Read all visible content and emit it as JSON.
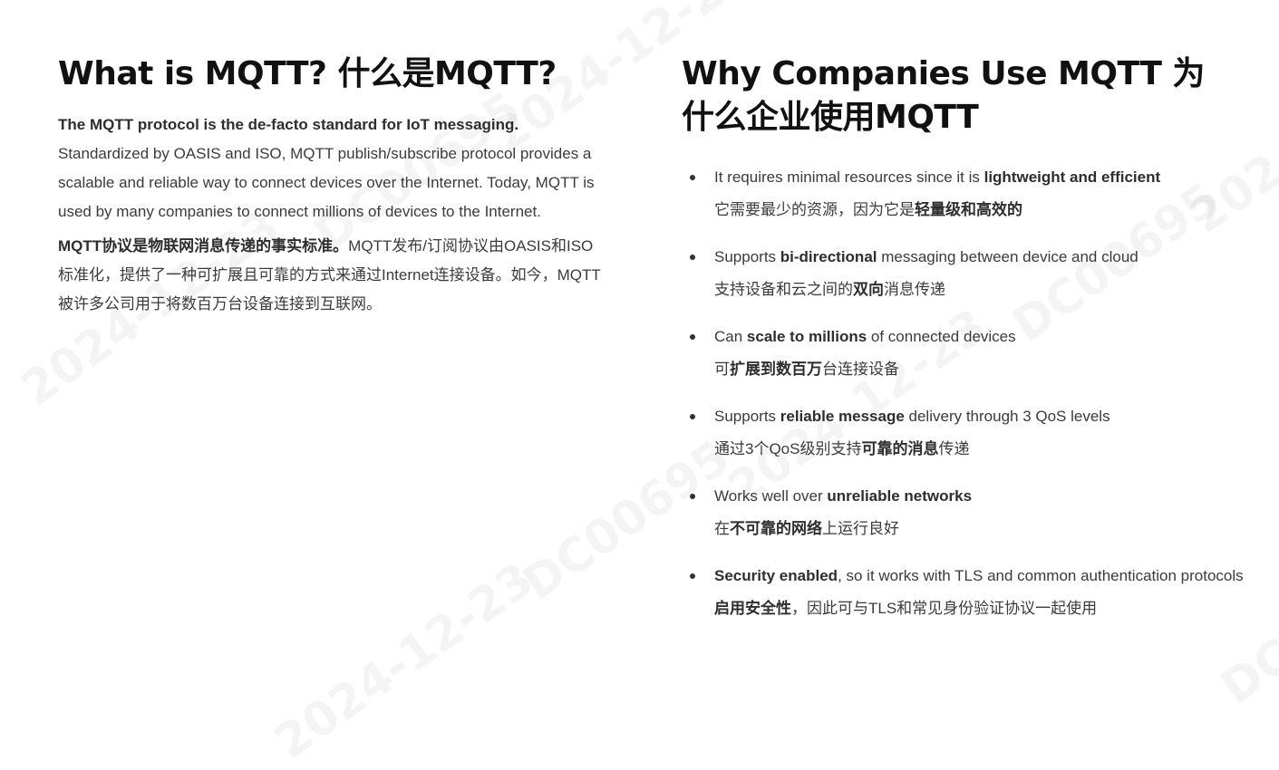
{
  "left": {
    "title": "What is MQTT?  什么是MQTT?",
    "intro_en_bold": "The MQTT protocol is the de-facto standard for IoT messaging.",
    "intro_en_rest": "Standardized by OASIS and ISO, MQTT publish/subscribe protocol provides a scalable and reliable way to connect devices over the Internet. Today, MQTT is used by many companies to connect millions of devices to the Internet.",
    "intro_zh_bold": "MQTT协议是物联网消息传递的事实标准。",
    "intro_zh_rest": "MQTT发布/订阅协议由OASIS和ISO标准化，提供了一种可扩展且可靠的方式来通过Internet连接设备。如今，MQTT被许多公司用于将数百万台设备连接到互联网。"
  },
  "right": {
    "title": "Why Companies Use MQTT  为什么企业使用MQTT",
    "items": [
      {
        "en_1": "It requires minimal resources since it is ",
        "en_b": "lightweight and efficient",
        "en_2": "",
        "zh_1": "它需要最少的资源，因为它是",
        "zh_b": "轻量级和高效的",
        "zh_2": ""
      },
      {
        "en_1": "Supports ",
        "en_b": "bi-directional",
        "en_2": " messaging between device and cloud",
        "zh_1": "支持设备和云之间的",
        "zh_b": "双向",
        "zh_2": "消息传递"
      },
      {
        "en_1": "Can ",
        "en_b": "scale to millions",
        "en_2": " of connected devices",
        "zh_1": "可",
        "zh_b": "扩展到数百万",
        "zh_2": "台连接设备"
      },
      {
        "en_1": "Supports ",
        "en_b": "reliable message",
        "en_2": " delivery through 3 QoS levels",
        "zh_1": "通过3个QoS级别支持",
        "zh_b": "可靠的消息",
        "zh_2": "传递"
      },
      {
        "en_1": "Works well over ",
        "en_b": "unreliable networks",
        "en_2": "",
        "zh_1": "在",
        "zh_b": "不可靠的网络",
        "zh_2": "上运行良好"
      },
      {
        "en_1": "",
        "en_b": "Security enabled",
        "en_2": ", so it works with TLS and common authentication protocols",
        "zh_1": "",
        "zh_b": "启用安全性",
        "zh_2": "，因此可与TLS和常见身份验证协议一起使用"
      }
    ]
  },
  "watermarks": {
    "date": "2024-12-23",
    "id": "DC00695"
  }
}
